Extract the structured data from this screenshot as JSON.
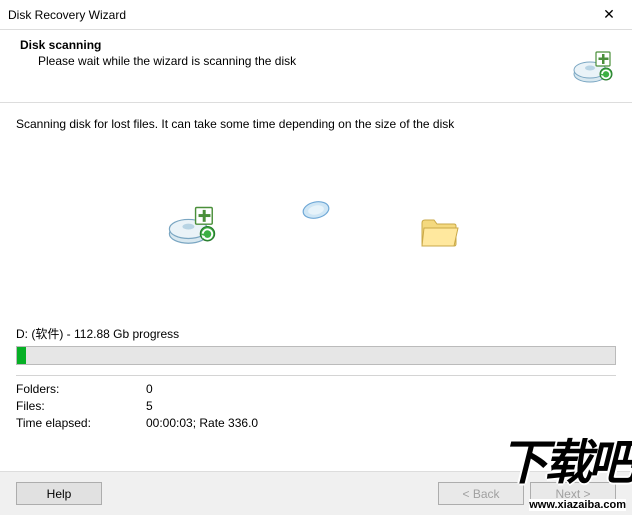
{
  "window": {
    "title": "Disk Recovery Wizard",
    "close_glyph": "✕"
  },
  "header": {
    "heading": "Disk scanning",
    "subheading": "Please wait while the wizard is scanning the disk"
  },
  "content": {
    "info": "Scanning disk for lost files. It can take some time depending on the size of the disk",
    "progress_label": "D: (软件) - 112.88 Gb progress",
    "progress_percent": 1.5
  },
  "stats": {
    "folders_label": "Folders:",
    "folders_value": "0",
    "files_label": "Files:",
    "files_value": "5",
    "time_label": "Time elapsed:",
    "time_value": "00:00:03; Rate 336.0"
  },
  "buttons": {
    "help": "Help",
    "back": "< Back",
    "next": "Next >"
  },
  "watermark": {
    "text": "下载吧",
    "url": "www.xiazaiba.com"
  },
  "icons": {
    "disk": "disk-recovery-icon",
    "search": "search-lens-icon",
    "folder": "folder-icon"
  }
}
